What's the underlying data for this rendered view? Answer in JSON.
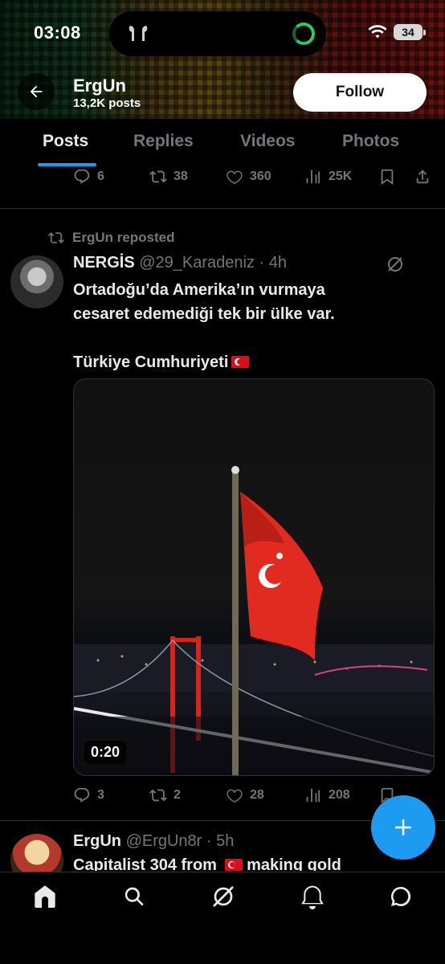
{
  "status_bar": {
    "time": "03:08",
    "battery": "34"
  },
  "header": {
    "profile_name": "ErgUn",
    "post_count": "13,2K posts",
    "follow_label": "Follow"
  },
  "tabs": [
    {
      "label": "Posts",
      "active": true
    },
    {
      "label": "Replies",
      "active": false
    },
    {
      "label": "Videos",
      "active": false
    },
    {
      "label": "Photos",
      "active": false
    }
  ],
  "previous_post_actions": {
    "replies": "6",
    "reposts": "38",
    "likes": "360",
    "views": "25K"
  },
  "tweet": {
    "reposted_by": "ErgUn reposted",
    "author_name": "NERGİS",
    "handle_time": "@29_Karadeniz · 4h",
    "line1": "Ortadoğu’da Amerika’ın vurmaya",
    "line2": "cesaret edemediği tek bir ülke var.",
    "line3": "Türkiye Cumhuriyeti",
    "video_duration": "0:20",
    "actions": {
      "replies": "3",
      "reposts": "2",
      "likes": "28",
      "views": "208"
    }
  },
  "next_tweet": {
    "author_name": "ErgUn",
    "handle_time": "@ErgUn8r · 5h",
    "text_start": "Capitalist 304 from",
    "text_end": "making gold"
  },
  "colors": {
    "accent": "#1d9bf0",
    "muted": "#71767b",
    "text": "#e7e9ea",
    "background": "#000000"
  },
  "icons": [
    "back-arrow-icon",
    "home-icon",
    "search-icon",
    "grok-icon",
    "bell-icon",
    "messages-icon",
    "compose-plus-icon",
    "reply-icon",
    "repost-icon",
    "like-icon",
    "views-icon",
    "bookmark-icon",
    "share-icon"
  ]
}
